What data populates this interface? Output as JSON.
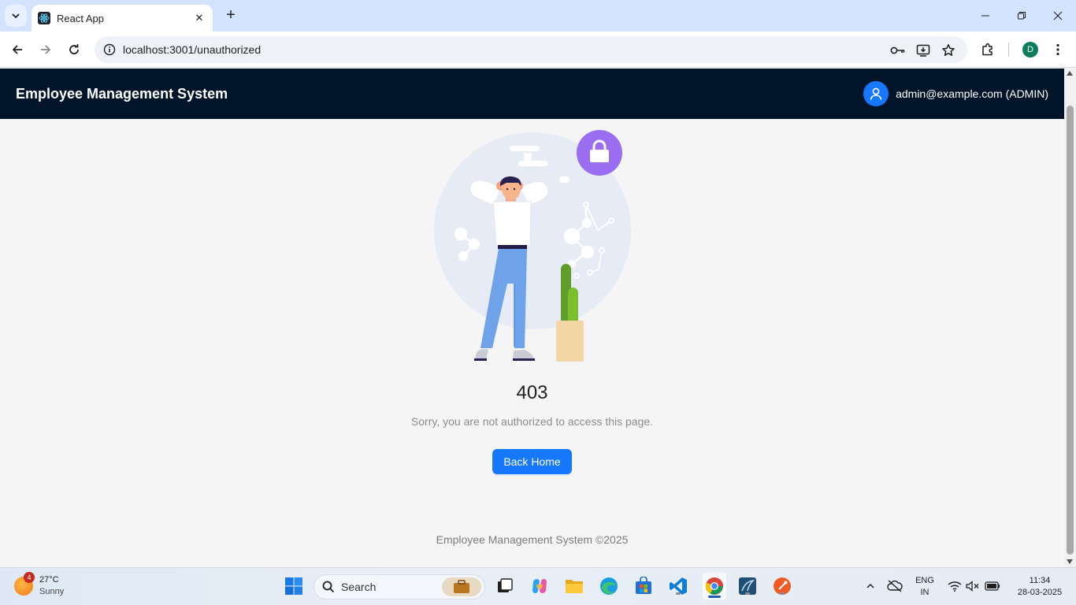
{
  "browser": {
    "tab_title": "React App",
    "url": "localhost:3001/unauthorized",
    "profile_initial": "D"
  },
  "header": {
    "title": "Employee Management System",
    "user": "admin@example.com (ADMIN)"
  },
  "error": {
    "code": "403",
    "message": "Sorry, you are not authorized to access this page.",
    "button": "Back Home"
  },
  "footer": {
    "text": "Employee Management System ©2025"
  },
  "taskbar": {
    "weather_badge": "4",
    "temperature": "27°C",
    "condition": "Sunny",
    "search_label": "Search",
    "lang_line1": "ENG",
    "lang_line2": "IN",
    "time": "11:34",
    "date": "28-03-2025"
  },
  "colors": {
    "header_bg": "#001529",
    "primary": "#1677ff",
    "lock_circle": "#9b6df0",
    "illustration_circle": "#e6ebf6"
  }
}
